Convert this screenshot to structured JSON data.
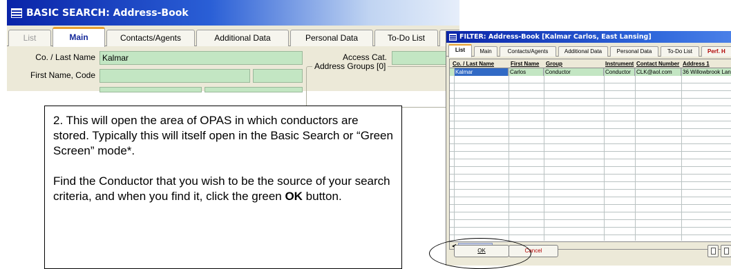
{
  "basic_search": {
    "title": "BASIC SEARCH: Address-Book",
    "tabs": [
      {
        "label": "List"
      },
      {
        "label": "Main"
      },
      {
        "label": "Contacts/Agents"
      },
      {
        "label": "Additional Data"
      },
      {
        "label": "Personal Data"
      },
      {
        "label": "To-Do List"
      }
    ],
    "fields": {
      "last_name_label": "Co. / Last Name",
      "last_name_value": "Kalmar",
      "first_name_label": "First Name, Code",
      "first_name_value": "",
      "access_cat_label": "Access Cat.",
      "access_cat_value": "",
      "address_groups_label": "Address Groups [0]"
    }
  },
  "callout": {
    "paragraph1": "2. This will open the area of OPAS in which conductors are stored. Typically this will itself open in the Basic Search or “Green Screen” mode*.",
    "paragraph2_prefix": "Find the Conductor that you wish to be the source of your search criteria, and when you find it, click the green ",
    "paragraph2_bold": "OK",
    "paragraph2_suffix": " button."
  },
  "filter_window": {
    "title": "FILTER: Address-Book [Kalmar Carlos, East Lansing]",
    "tabs": [
      {
        "label": "List"
      },
      {
        "label": "Main"
      },
      {
        "label": "Contacts/Agents"
      },
      {
        "label": "Additional Data"
      },
      {
        "label": "Personal Data"
      },
      {
        "label": "To-Do List"
      },
      {
        "label": "Perf. H"
      }
    ],
    "columns": [
      "Co. / Last Name",
      "First Name",
      "Group",
      "Instrument",
      "Contact Number",
      "Address 1"
    ],
    "rows": [
      [
        "Kalmar",
        "Carlos",
        "Conductor",
        "Conductor",
        "CLK@aol.com",
        "36 Willowbrook Lan"
      ]
    ],
    "ok_label": "OK",
    "cancel_label": "Cancel"
  }
}
